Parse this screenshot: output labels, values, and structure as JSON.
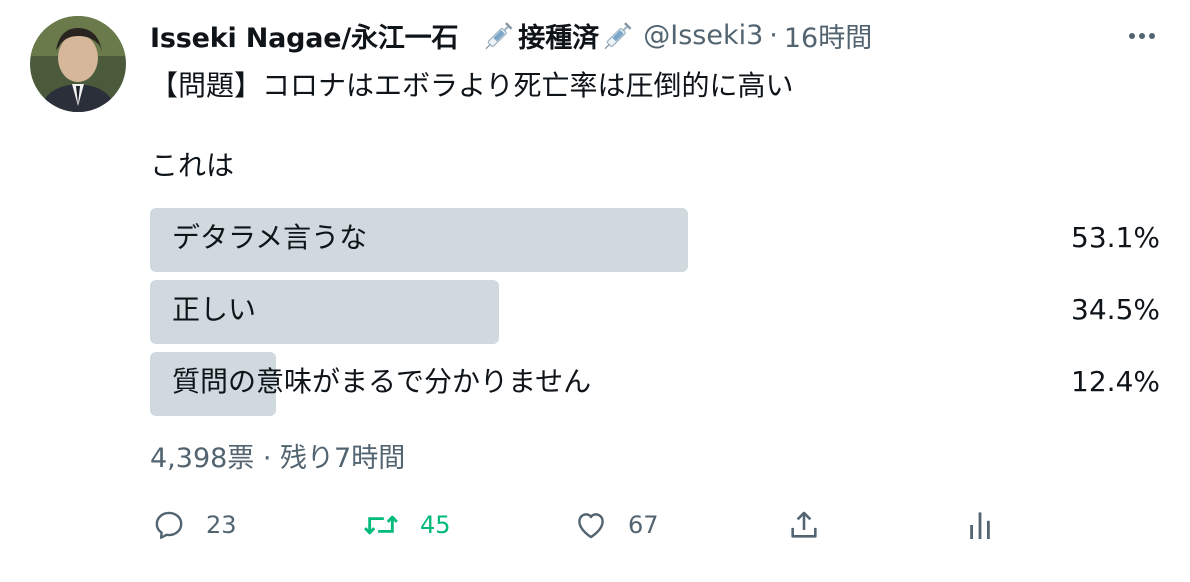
{
  "tweet": {
    "display_name": "Isseki Nagae/永江一石",
    "badge_text": "接種済",
    "handle": "@Isseki3",
    "separator": "·",
    "time": "16時間",
    "text_line_1": "【問題】コロナはエボラより死亡率は圧倒的に高い",
    "text_line_2": "これは"
  },
  "poll": {
    "options": [
      {
        "label": "デタラメ言うな",
        "percent_text": "53.1%",
        "percent": 53.1
      },
      {
        "label": "正しい",
        "percent_text": "34.5%",
        "percent": 34.5
      },
      {
        "label": "質問の意味がまるで分かりません",
        "percent_text": "12.4%",
        "percent": 12.4
      }
    ],
    "meta": "4,398票 · 残り7時間"
  },
  "actions": {
    "reply_count": "23",
    "retweet_count": "45",
    "like_count": "67"
  },
  "icons": {
    "avatar": "profile-photo",
    "badge": "syringe-icon",
    "more": "more-icon",
    "reply": "reply-icon",
    "retweet": "retweet-icon",
    "like": "heart-icon",
    "share": "share-icon",
    "analytics": "analytics-icon"
  },
  "colors": {
    "text": "#0f1419",
    "secondary": "#536471",
    "poll_bar": "#cfd9de",
    "retweet_green": "#00ba7c"
  }
}
